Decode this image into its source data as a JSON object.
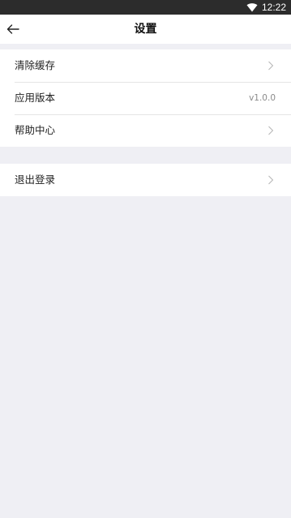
{
  "status_bar": {
    "time": "12:22",
    "icons": [
      "wifi-icon"
    ]
  },
  "nav": {
    "title": "设置",
    "back_icon": "arrow-left-icon"
  },
  "settings": {
    "group1": [
      {
        "label": "清除缓存",
        "value": "",
        "icon": "chevron-right-icon"
      },
      {
        "label": "应用版本",
        "value": "v1.0.0",
        "icon": ""
      },
      {
        "label": "帮助中心",
        "value": "",
        "icon": "chevron-right-icon"
      }
    ],
    "group2": [
      {
        "label": "退出登录",
        "value": "",
        "icon": "chevron-right-icon"
      }
    ]
  },
  "colors": {
    "status_bar_bg": "#2c2c2c",
    "page_bg": "#efeff4",
    "cell_bg": "#ffffff",
    "divider": "#e5e5e5",
    "secondary_text": "#8a8a8a"
  }
}
